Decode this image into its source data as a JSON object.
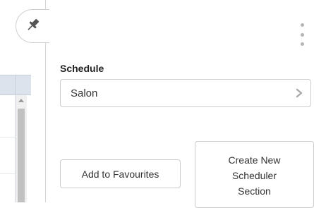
{
  "schedule": {
    "label": "Schedule",
    "selected": "Salon"
  },
  "actions": {
    "add_to_favourites": "Add to Favourites",
    "create_section": [
      "Create New",
      "Scheduler",
      "Section"
    ]
  },
  "icons": {
    "pin": "pin-icon",
    "more": "kebab-menu-icon",
    "select_arrow": "chevron-right-icon",
    "scroll_up": "scroll-up-arrow-icon"
  },
  "colors": {
    "grid_header": "#dde3ec",
    "border": "#cccccc",
    "icon_gray": "#b5b5b5"
  }
}
